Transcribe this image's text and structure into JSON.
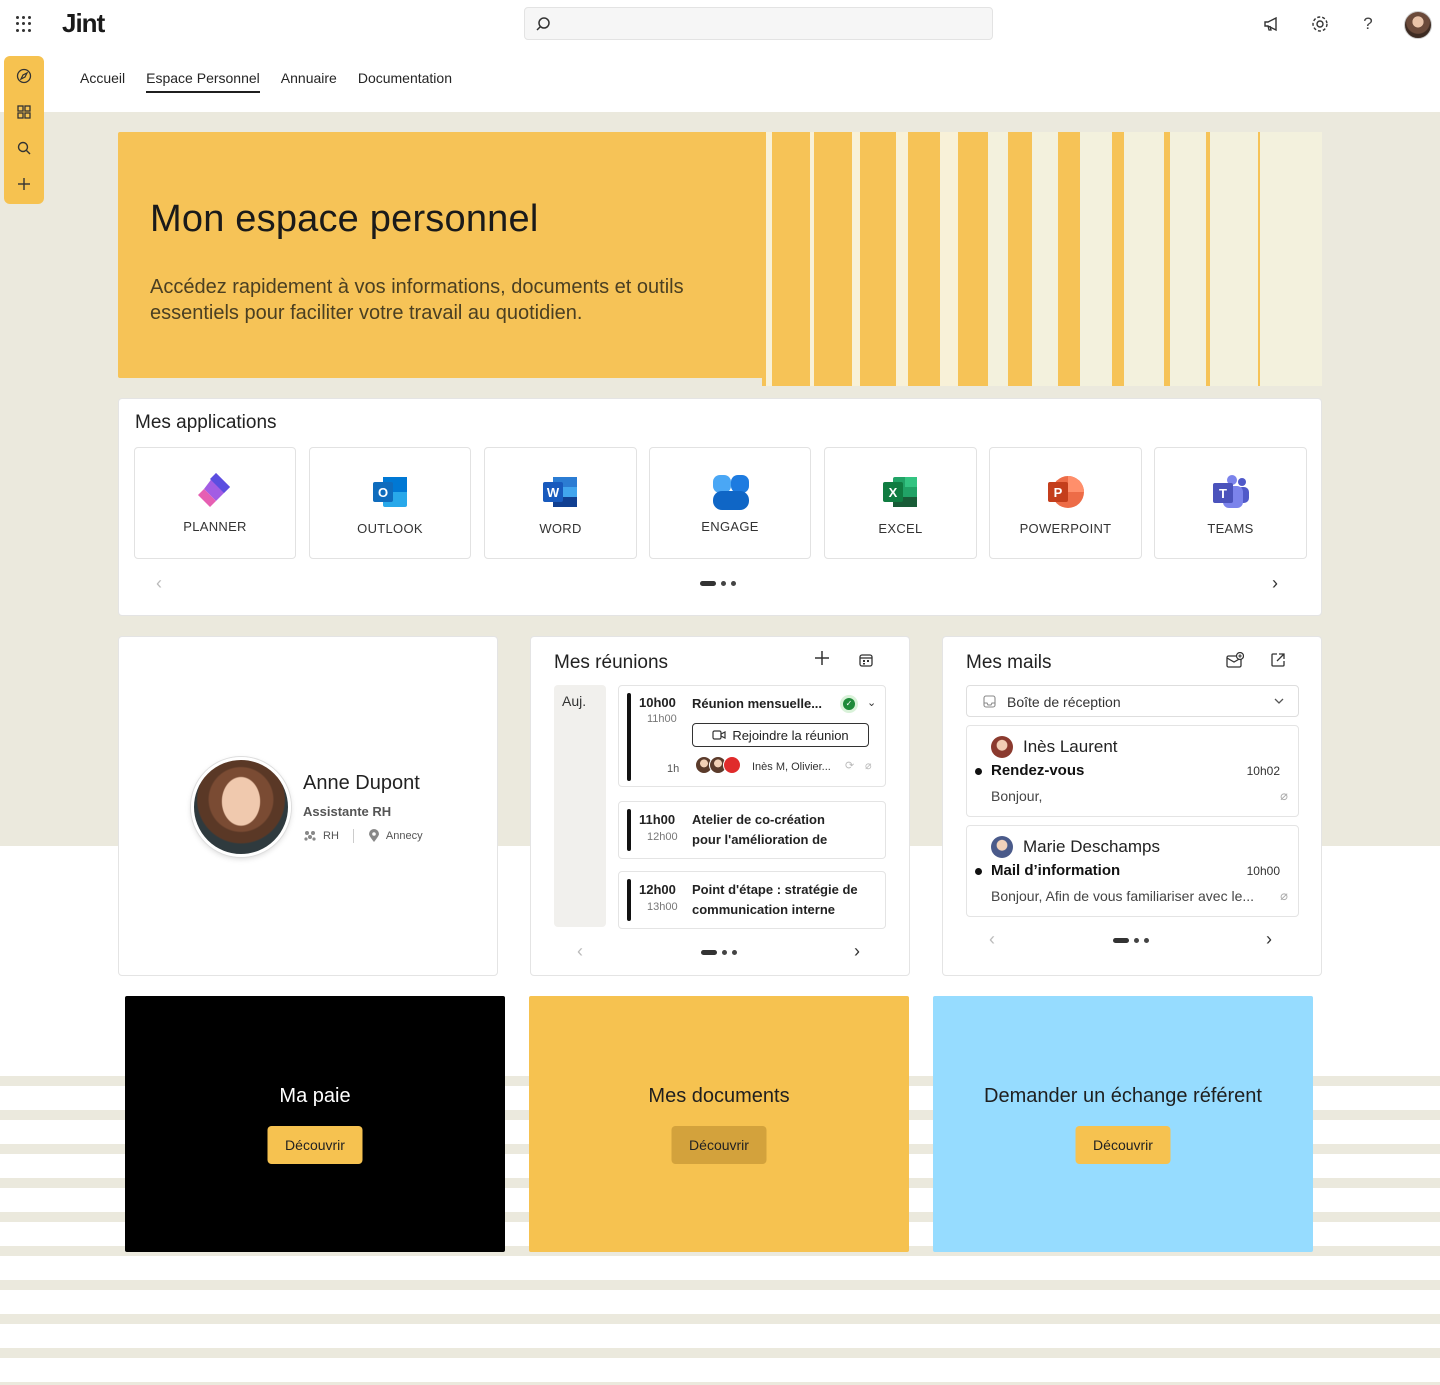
{
  "brand": {
    "logo_text": "Jint"
  },
  "search": {
    "placeholder": ""
  },
  "nav": {
    "tabs": [
      "Accueil",
      "Espace Personnel",
      "Annuaire",
      "Documentation"
    ],
    "active": "Espace Personnel"
  },
  "hero": {
    "title": "Mon espace personnel",
    "subtitle": "Accédez rapidement à vos informations, documents et outils essentiels pour faciliter votre travail au quotidien."
  },
  "apps": {
    "title": "Mes applications",
    "items": [
      {
        "label": "PLANNER",
        "icon": "planner-icon",
        "color": "#7b3fe4"
      },
      {
        "label": "OUTLOOK",
        "icon": "outlook-icon",
        "color": "#0f6cbd"
      },
      {
        "label": "WORD",
        "icon": "word-icon",
        "color": "#185abd"
      },
      {
        "label": "ENGAGE",
        "icon": "engage-icon",
        "color": "#1f7be0"
      },
      {
        "label": "EXCEL",
        "icon": "excel-icon",
        "color": "#107c41"
      },
      {
        "label": "POWERPOINT",
        "icon": "powerpoint-icon",
        "color": "#c43e1c"
      },
      {
        "label": "TEAMS",
        "icon": "teams-icon",
        "color": "#5059c9"
      }
    ]
  },
  "profile": {
    "name": "Anne Dupont",
    "role": "Assistante RH",
    "department": "RH",
    "location": "Annecy"
  },
  "meetings": {
    "title": "Mes réunions",
    "day_label": "Auj.",
    "items": [
      {
        "start": "10h00",
        "end": "11h00",
        "title": "Réunion mensuelle...",
        "duration": "1h",
        "join_label": "Rejoindre la réunion",
        "attendees": "Inès M, Olivier..."
      },
      {
        "start": "11h00",
        "end": "12h00",
        "title_line1": "Atelier de co-création",
        "title_line2": "pour l'amélioration de"
      },
      {
        "start": "12h00",
        "end": "13h00",
        "title_line1": "Point d'étape : stratégie de",
        "title_line2": "communication interne"
      }
    ]
  },
  "mails": {
    "title": "Mes mails",
    "folder": "Boîte de réception",
    "items": [
      {
        "from": "Inès Laurent",
        "subject": "Rendez-vous",
        "time": "10h02",
        "preview": "Bonjour,"
      },
      {
        "from": "Marie Deschamps",
        "subject": "Mail d’information",
        "time": "10h00",
        "preview": "Bonjour, Afin de vous familiariser avec le..."
      }
    ]
  },
  "tiles": [
    {
      "title": "Ma paie",
      "button": "Découvrir",
      "bg": "#000000",
      "fg": "#ffffff",
      "btn_bg": "#f6c250"
    },
    {
      "title": "Mes documents",
      "button": "Découvrir",
      "bg": "#f6c250",
      "fg": "#1f1f1f",
      "btn_bg": "#d3a23c"
    },
    {
      "title": "Demander un échange référent",
      "button": "Découvrir",
      "bg": "#96dcff",
      "fg": "#1f1f1f",
      "btn_bg": "#f6c250"
    }
  ],
  "colors": {
    "accent": "#f6c250",
    "beige": "#ebe9dd"
  }
}
